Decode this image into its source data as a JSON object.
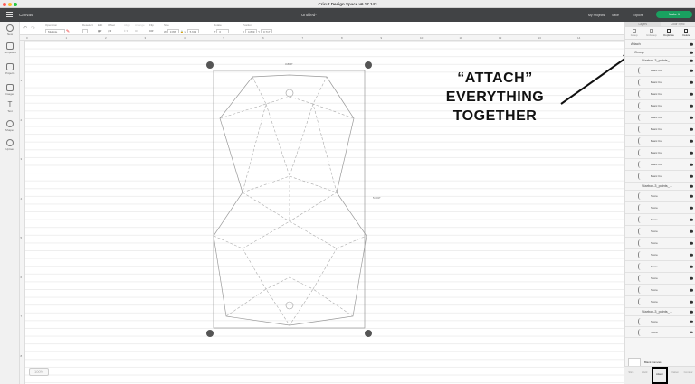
{
  "window": {
    "title": "Cricut Design Space  v6.17.143"
  },
  "header": {
    "section": "Canvas",
    "doc_title": "Untitled*",
    "my_projects": "My Projects",
    "save": "Save",
    "machine": "Explore",
    "make_it": "Make It",
    "accent": "#1aa160"
  },
  "toolbar": {
    "operation_label": "Operation",
    "operation_value": "Multiple",
    "deselect": "Deselect",
    "edit": "Edit",
    "offset": "Offset",
    "align": "Align",
    "arrange": "Arrange",
    "flip": "Flip",
    "size": "Size",
    "w": "W",
    "w_value": "3.809",
    "h": "H",
    "h_value": "5.603",
    "rotate": "Rotate",
    "rotate_value": "0",
    "position": "Position",
    "x": "X",
    "x_value": "4.899",
    "y": "Y",
    "y_value": "0.717"
  },
  "leftbar": [
    {
      "label": "New"
    },
    {
      "label": "Templates"
    },
    {
      "label": "Projects"
    },
    {
      "label": "Images"
    },
    {
      "label": "Text"
    },
    {
      "label": "Shapes"
    },
    {
      "label": "Upload"
    }
  ],
  "ruler": {
    "h": [
      "0",
      "1",
      "2",
      "3",
      "4",
      "5",
      "6",
      "7",
      "8",
      "9",
      "10",
      "11",
      "12",
      "13",
      "14"
    ],
    "v": [
      "1",
      "2",
      "3",
      "4",
      "5",
      "6",
      "7",
      "8"
    ]
  },
  "canvas": {
    "width_label": "3.809\"",
    "height_label": "5.603\"",
    "zoom": "100%"
  },
  "annotation": {
    "lines": [
      "“ATTACH”",
      "EVERYTHING",
      "TOGETHER"
    ]
  },
  "panel": {
    "tabs": [
      "Layers",
      "Color Sync"
    ],
    "actions": [
      "Group",
      "UnGroup",
      "Duplicate",
      "Delete"
    ],
    "attach": "Attach",
    "group": "Group",
    "sub1": "Starbox-3_points_...",
    "cuts": [
      "Basic Cut",
      "Basic Cut",
      "Basic Cut",
      "Basic Cut",
      "Basic Cut",
      "Basic Cut",
      "Basic Cut",
      "Basic Cut",
      "Basic Cut",
      "Basic Cut"
    ],
    "sub2": "Starbox-3_points_...",
    "scores": [
      "Score",
      "Score",
      "Score",
      "Score",
      "Score",
      "Score",
      "Score",
      "Score",
      "Score",
      "Score"
    ],
    "sub3": "Starbox-3_points_...",
    "scores2": [
      "Score",
      "Score"
    ],
    "blank_canvas": "Blank Canvas",
    "bottom": [
      "Slice",
      "Weld",
      "Attach",
      "Flatten",
      "Contour"
    ]
  }
}
